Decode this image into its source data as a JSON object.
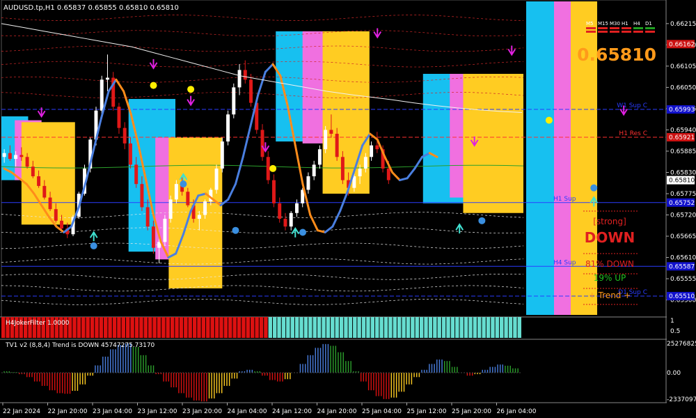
{
  "main": {
    "header": "AUDUSD.tp,H1  0.65837 0.65855 0.65810 0.65810",
    "big_price": "0.65810",
    "price_min": 0.65465,
    "price_max": 0.6624,
    "price_ticks": [
      "0.66215",
      "0.66160",
      "0.66105",
      "0.66050",
      "0.65995",
      "0.65940",
      "0.65885",
      "0.65830",
      "0.65775",
      "0.65720",
      "0.65665",
      "0.65610",
      "0.65555",
      "0.65500"
    ],
    "price_tick_values": [
      0.66215,
      0.6616,
      0.66105,
      0.6605,
      0.65995,
      0.6594,
      0.65885,
      0.6583,
      0.65775,
      0.6572,
      0.65665,
      0.6561,
      0.65555,
      0.655
    ],
    "tags": [
      {
        "text": "0.66162",
        "value": 0.66162,
        "color": "#cc1111"
      },
      {
        "text": "0.65993",
        "value": 0.65993,
        "color": "#1111cc"
      },
      {
        "text": "0.65921",
        "value": 0.65921,
        "color": "#cc1111"
      },
      {
        "text": "0.65810",
        "value": 0.6581,
        "color": "#ffffff"
      },
      {
        "text": "0.65752",
        "value": 0.65752,
        "color": "#1111cc"
      },
      {
        "text": "0.65587",
        "value": 0.65587,
        "color": "#1111cc"
      },
      {
        "text": "0.65510",
        "value": 0.6551,
        "color": "#1111cc"
      }
    ],
    "levels": [
      {
        "label": "W1 Sup C",
        "value": 0.65993,
        "color": "#2a3cff"
      },
      {
        "label": "H1 Res C",
        "value": 0.65921,
        "color": "#ff3030"
      },
      {
        "label": "H1 Sup",
        "value": 0.65752,
        "color": "#2a3cff"
      },
      {
        "label": "H4 Sup",
        "value": 0.65587,
        "color": "#2a3cff"
      },
      {
        "label": "D1 Sup C",
        "value": 0.6551,
        "color": "#2a3cff"
      }
    ],
    "timeframes": [
      "M5",
      "M15",
      "M30",
      "H1",
      "H4",
      "D1"
    ],
    "panel": {
      "strong": "[strong]",
      "direction": "DOWN",
      "down_line": "81%  DOWN",
      "up_line": "19%        UP",
      "trend_line": "+   Trend   +"
    },
    "candles": [
      [
        0.6587,
        0.6589,
        0.65855,
        0.6588
      ],
      [
        0.6588,
        0.659,
        0.6586,
        0.65865
      ],
      [
        0.65865,
        0.65885,
        0.65845,
        0.65875
      ],
      [
        0.65875,
        0.65895,
        0.6586,
        0.6587
      ],
      [
        0.6587,
        0.6588,
        0.6584,
        0.65845
      ],
      [
        0.65845,
        0.6586,
        0.65815,
        0.6582
      ],
      [
        0.6582,
        0.65835,
        0.6579,
        0.65795
      ],
      [
        0.65795,
        0.6581,
        0.6576,
        0.65765
      ],
      [
        0.65765,
        0.6578,
        0.6573,
        0.65735
      ],
      [
        0.65735,
        0.6575,
        0.657,
        0.65705
      ],
      [
        0.65705,
        0.6572,
        0.6568,
        0.65685
      ],
      [
        0.65685,
        0.657,
        0.6566,
        0.6567
      ],
      [
        0.6567,
        0.6572,
        0.65665,
        0.65715
      ],
      [
        0.65715,
        0.6578,
        0.6571,
        0.65775
      ],
      [
        0.65775,
        0.6585,
        0.6577,
        0.6584
      ],
      [
        0.6584,
        0.6592,
        0.6583,
        0.65915
      ],
      [
        0.65915,
        0.66,
        0.659,
        0.6599
      ],
      [
        0.6599,
        0.6608,
        0.6598,
        0.6607
      ],
      [
        0.6607,
        0.66135,
        0.6604,
        0.66075
      ],
      [
        0.66075,
        0.6609,
        0.6599,
        0.66
      ],
      [
        0.66,
        0.6601,
        0.6593,
        0.65945
      ],
      [
        0.65945,
        0.6596,
        0.6589,
        0.65905
      ],
      [
        0.65905,
        0.6592,
        0.6584,
        0.6585
      ],
      [
        0.6585,
        0.6587,
        0.6579,
        0.658
      ],
      [
        0.658,
        0.6582,
        0.6573,
        0.6574
      ],
      [
        0.6574,
        0.6576,
        0.6568,
        0.6569
      ],
      [
        0.6569,
        0.65705,
        0.6562,
        0.65635
      ],
      [
        0.65635,
        0.6566,
        0.65595,
        0.6565
      ],
      [
        0.6565,
        0.6572,
        0.6564,
        0.6571
      ],
      [
        0.6571,
        0.6577,
        0.657,
        0.6576
      ],
      [
        0.6576,
        0.6581,
        0.6575,
        0.658
      ],
      [
        0.658,
        0.6582,
        0.6577,
        0.6578
      ],
      [
        0.6578,
        0.6579,
        0.6574,
        0.65745
      ],
      [
        0.65745,
        0.6576,
        0.657,
        0.6571
      ],
      [
        0.6571,
        0.6573,
        0.6568,
        0.6572
      ],
      [
        0.6572,
        0.6576,
        0.6571,
        0.65755
      ],
      [
        0.65755,
        0.6579,
        0.65745,
        0.65785
      ],
      [
        0.65785,
        0.6585,
        0.65775,
        0.6584
      ],
      [
        0.6584,
        0.6592,
        0.6583,
        0.6591
      ],
      [
        0.6591,
        0.6599,
        0.659,
        0.6598
      ],
      [
        0.6598,
        0.6606,
        0.6597,
        0.6605
      ],
      [
        0.6605,
        0.6611,
        0.6603,
        0.66095
      ],
      [
        0.66095,
        0.6612,
        0.6606,
        0.6607
      ],
      [
        0.6607,
        0.66085,
        0.66,
        0.6601
      ],
      [
        0.6601,
        0.6602,
        0.6593,
        0.6594
      ],
      [
        0.6594,
        0.65955,
        0.6586,
        0.6587
      ],
      [
        0.6587,
        0.65885,
        0.658,
        0.6581
      ],
      [
        0.6581,
        0.65825,
        0.6574,
        0.6575
      ],
      [
        0.6575,
        0.65765,
        0.657,
        0.6571
      ],
      [
        0.6571,
        0.65725,
        0.6568,
        0.6569
      ],
      [
        0.6569,
        0.6573,
        0.6568,
        0.65725
      ],
      [
        0.65725,
        0.6576,
        0.65715,
        0.6575
      ],
      [
        0.6575,
        0.6579,
        0.6574,
        0.65785
      ],
      [
        0.65785,
        0.6583,
        0.65775,
        0.6582
      ],
      [
        0.6582,
        0.6586,
        0.6581,
        0.6585
      ],
      [
        0.6585,
        0.659,
        0.6584,
        0.6589
      ],
      [
        0.6589,
        0.6595,
        0.6588,
        0.6594
      ],
      [
        0.6594,
        0.6598,
        0.6592,
        0.6593
      ],
      [
        0.6593,
        0.65945,
        0.6586,
        0.6587
      ],
      [
        0.6587,
        0.65885,
        0.658,
        0.6581
      ],
      [
        0.6581,
        0.6583,
        0.6577,
        0.6579
      ],
      [
        0.6579,
        0.6583,
        0.6578,
        0.6582
      ],
      [
        0.6582,
        0.6585,
        0.658,
        0.6584
      ],
      [
        0.6584,
        0.6588,
        0.6583,
        0.6587
      ],
      [
        0.6587,
        0.6591,
        0.6586,
        0.659
      ],
      [
        0.659,
        0.65935,
        0.6588,
        0.6589
      ],
      [
        0.6589,
        0.659,
        0.6583,
        0.6584
      ],
      [
        0.6584,
        0.6586,
        0.658,
        0.6581
      ]
    ],
    "smooth_line": [
      0.6584,
      0.6583,
      0.65815,
      0.658,
      0.65775,
      0.65745,
      0.65715,
      0.6569,
      0.65675,
      0.6569,
      0.6574,
      0.6581,
      0.6589,
      0.6597,
      0.6604,
      0.6607,
      0.6604,
      0.6598,
      0.659,
      0.6581,
      0.6572,
      0.6565,
      0.6561,
      0.6562,
      0.6567,
      0.6573,
      0.6577,
      0.65775,
      0.6576,
      0.65745,
      0.6576,
      0.658,
      0.6587,
      0.6595,
      0.6603,
      0.6609,
      0.6611,
      0.6608,
      0.66,
      0.659,
      0.658,
      0.6572,
      0.6568,
      0.65675,
      0.6569,
      0.6573,
      0.6578,
      0.6584,
      0.659,
      0.6593,
      0.65915,
      0.6587,
      0.6583,
      0.6581,
      0.65815,
      0.6584,
      0.6587,
      0.6588,
      0.6587
    ],
    "ma_line": [
      0.66215,
      0.66205,
      0.66195,
      0.66185,
      0.66175,
      0.66165,
      0.66155,
      0.6614,
      0.66125,
      0.6611,
      0.66095,
      0.6608,
      0.6607,
      0.6606,
      0.6605,
      0.6604,
      0.66032,
      0.66025,
      0.66018,
      0.6601,
      0.66003,
      0.65997,
      0.65992,
      0.65988,
      0.65985
    ],
    "boxes": [
      {
        "from": 0,
        "to": 3,
        "top": 0.65975,
        "bottom": 0.6581,
        "color": "#17c0f0"
      },
      {
        "from": 2,
        "to": 5,
        "top": 0.65965,
        "bottom": 0.6581,
        "color": "#f070e0"
      },
      {
        "from": 3,
        "to": 10,
        "top": 0.6596,
        "bottom": 0.65695,
        "color": "#ffcc22"
      },
      {
        "from": 19,
        "to": 25,
        "top": 0.6602,
        "bottom": 0.65625,
        "color": "#17c0f0"
      },
      {
        "from": 23,
        "to": 28,
        "top": 0.6592,
        "bottom": 0.65605,
        "color": "#f070e0"
      },
      {
        "from": 25,
        "to": 32,
        "top": 0.6592,
        "bottom": 0.6553,
        "color": "#ffcc22"
      },
      {
        "from": 41,
        "to": 46,
        "top": 0.66195,
        "bottom": 0.6591,
        "color": "#17c0f0"
      },
      {
        "from": 45,
        "to": 49,
        "top": 0.66195,
        "bottom": 0.65905,
        "color": "#f070e0"
      },
      {
        "from": 48,
        "to": 54,
        "top": 0.66195,
        "bottom": 0.65775,
        "color": "#ffcc22"
      },
      {
        "from": 63,
        "to": 69,
        "top": 0.66085,
        "bottom": 0.6575,
        "color": "#17c0f0"
      },
      {
        "from": 67,
        "to": 71,
        "top": 0.66085,
        "bottom": 0.65765,
        "color": "#f070e0"
      },
      {
        "from": 69,
        "to": 77,
        "top": 0.66085,
        "bottom": 0.65725,
        "color": "#ffcc22"
      }
    ],
    "signals_down": [
      [
        5,
        0.6598
      ],
      [
        20,
        0.66105
      ],
      [
        25,
        0.6601
      ],
      [
        35,
        0.6589
      ],
      [
        50,
        0.66185
      ],
      [
        68,
        0.6614
      ],
      [
        63,
        0.65905
      ],
      [
        83,
        0.65985
      ]
    ],
    "signals_up": [
      [
        12,
        0.6567
      ],
      [
        24,
        0.6582
      ],
      [
        39,
        0.6568
      ],
      [
        61,
        0.6569
      ],
      [
        79,
        0.6576
      ]
    ],
    "dots_yellow": [
      [
        20,
        0.66055
      ],
      [
        25,
        0.66045
      ],
      [
        36,
        0.6584
      ],
      [
        73,
        0.65965
      ]
    ],
    "dots_blue": [
      [
        12,
        0.6564
      ],
      [
        24,
        0.658
      ],
      [
        31,
        0.6568
      ],
      [
        40,
        0.65675
      ],
      [
        64,
        0.65705
      ],
      [
        79,
        0.6579
      ]
    ]
  },
  "filter": {
    "label": "H4JokerFilter 1.0000",
    "ticks": [
      "1",
      "0.5"
    ],
    "red_bars": 60,
    "teal_bars": 57
  },
  "oscillator": {
    "label": "TV1 v2 (8,8,4) Trend is DOWN 45747275.73170",
    "ticks": [
      "25276825",
      "0.00",
      "-23370973"
    ],
    "values": [
      0.05,
      0.02,
      -0.05,
      -0.15,
      -0.3,
      -0.45,
      -0.6,
      -0.7,
      -0.72,
      -0.62,
      -0.4,
      -0.1,
      0.25,
      0.55,
      0.8,
      0.95,
      1.0,
      0.88,
      0.6,
      0.25,
      -0.05,
      -0.3,
      -0.5,
      -0.7,
      -0.85,
      -0.95,
      -0.98,
      -0.88,
      -0.7,
      -0.45,
      -0.2,
      0.05,
      0.1,
      0.05,
      -0.1,
      -0.25,
      -0.3,
      -0.22,
      0.0,
      0.3,
      0.6,
      0.85,
      0.98,
      0.92,
      0.7,
      0.4,
      0.05,
      -0.3,
      -0.6,
      -0.8,
      -0.9,
      -0.85,
      -0.65,
      -0.4,
      -0.15,
      0.1,
      0.3,
      0.45,
      0.4,
      0.2,
      0.0,
      -0.1,
      -0.05,
      0.1,
      0.2,
      0.28,
      0.24,
      0.15
    ]
  },
  "time_axis": [
    "22 Jan 2024",
    "22 Jan 20:00",
    "23 Jan 04:00",
    "23 Jan 12:00",
    "23 Jan 20:00",
    "24 Jan 04:00",
    "24 Jan 12:00",
    "24 Jan 20:00",
    "25 Jan 04:00",
    "25 Jan 12:00",
    "25 Jan 20:00",
    "26 Jan 04:00"
  ]
}
